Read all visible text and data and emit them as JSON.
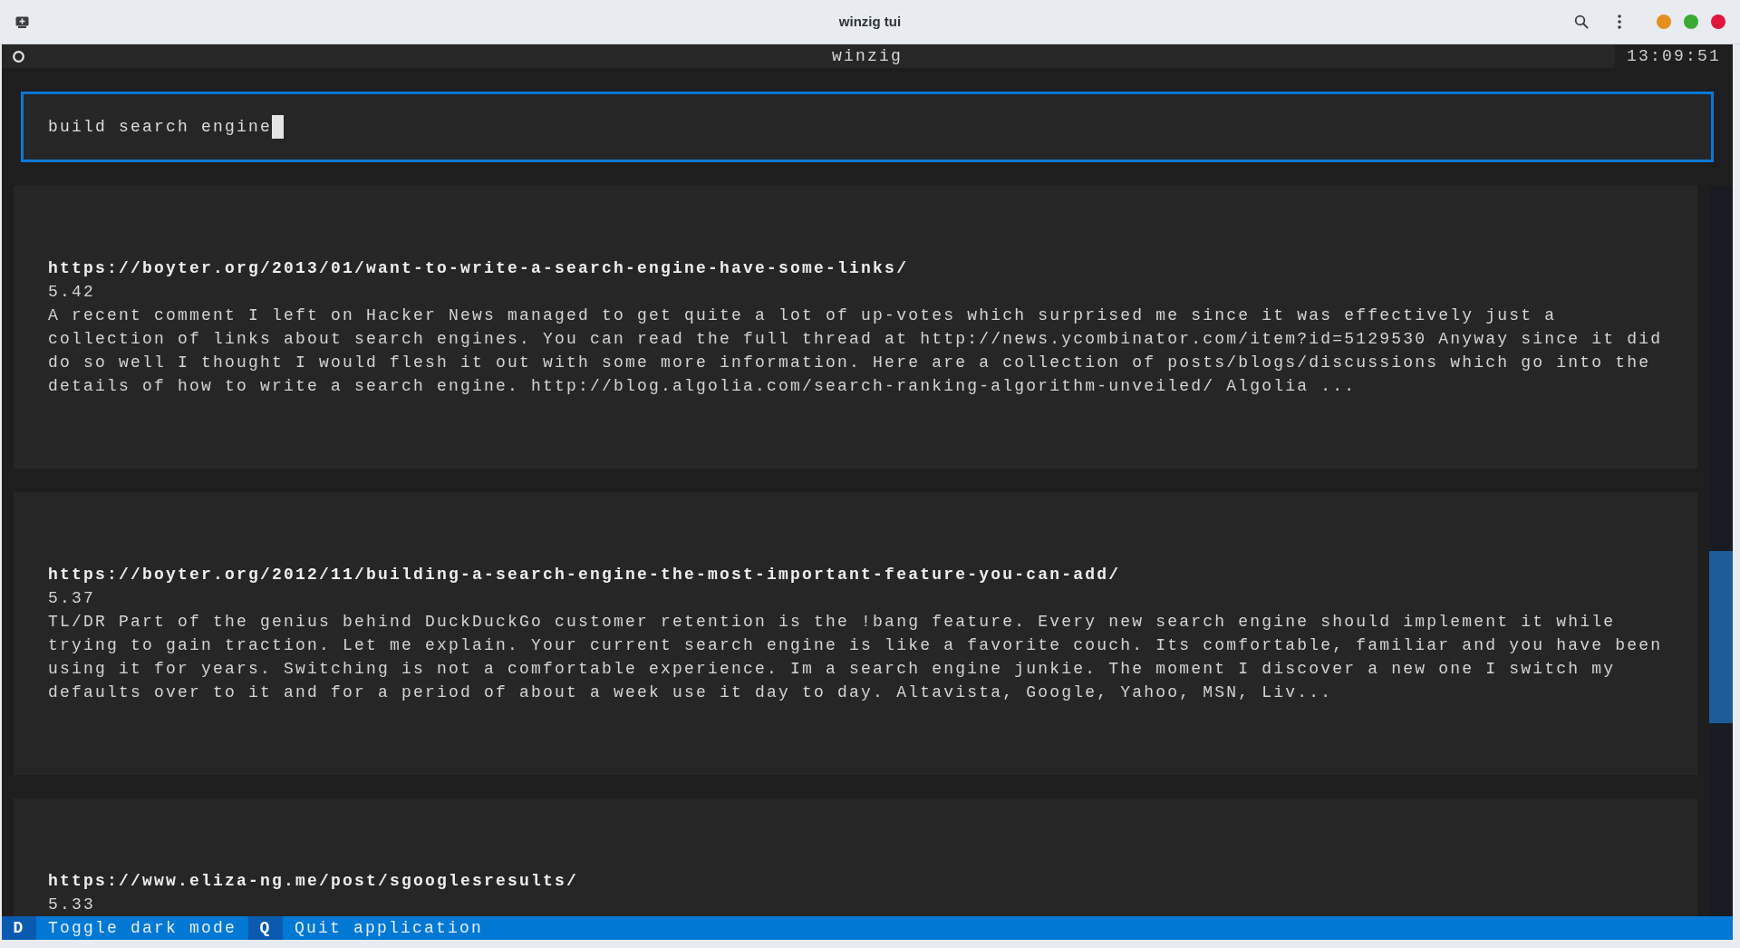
{
  "window": {
    "title": "winzig tui"
  },
  "header": {
    "title": "winzig",
    "clock": "13:09:51"
  },
  "search": {
    "value": "build search engine",
    "focused": true
  },
  "results": [
    {
      "url": "https://boyter.org/2013/01/want-to-write-a-search-engine-have-some-links/",
      "score": "5.42",
      "snippet": "A recent comment I left on Hacker News managed to get quite a lot of up-votes which surprised me since it was effectively just a collection of links about search engines. You can read the full thread at http://news.ycombinator.com/item?id=5129530 Anyway since it did do so well I thought I would flesh it out with some more information. Here are a collection of posts/blogs/discussions which go into the details of how to write a search engine. http://blog.algolia.com/search-ranking-algorithm-unveiled/ Algolia ..."
    },
    {
      "url": "https://boyter.org/2012/11/building-a-search-engine-the-most-important-feature-you-can-add/",
      "score": "5.37",
      "snippet": "TL/DR Part of the genius behind DuckDuckGo customer retention is the !bang feature. Every new search engine should implement it while trying to gain traction. Let me explain. Your current search engine is like a favorite couch. Its comfortable, familiar and you have been using it for years. Switching is not a comfortable experience. Im a search engine junkie. The moment I discover a new one I switch my defaults over to it and for a period of about a week use it day to day. Altavista, Google, Yahoo, MSN, Liv..."
    },
    {
      "url": "https://www.eliza-ng.me/post/sgooglesresults/",
      "score": "5.33"
    }
  ],
  "footer": {
    "bindings": [
      {
        "key": "D",
        "label": "Toggle dark mode"
      },
      {
        "key": "Q",
        "label": "Quit application"
      }
    ]
  }
}
